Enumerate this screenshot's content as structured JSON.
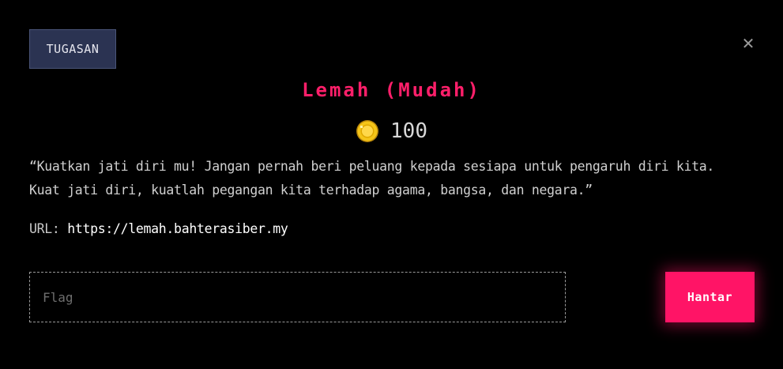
{
  "header": {
    "category_button_label": "TUGASAN",
    "close_icon": "close-icon",
    "close_glyph": "✕"
  },
  "challenge": {
    "title": "Lemah (Mudah)",
    "coin_icon": "coin-icon",
    "points": "100",
    "description_line1": "“Kuatkan jati diri mu! Jangan pernah beri peluang kepada sesiapa untuk pengaruh diri kita.",
    "description_line2": "Kuat jati diri, kuatlah pegangan kita terhadap agama, bangsa, dan negara.”",
    "url_label": "URL:",
    "url": "https://lemah.bahterasiber.my"
  },
  "form": {
    "flag_placeholder": "Flag",
    "flag_value": "",
    "submit_label": "Hantar"
  },
  "colors": {
    "background": "#000000",
    "accent": "#ff1466",
    "title": "#ff1f6a",
    "category_button_bg": "#2b3352",
    "coin": "#f5c518"
  }
}
